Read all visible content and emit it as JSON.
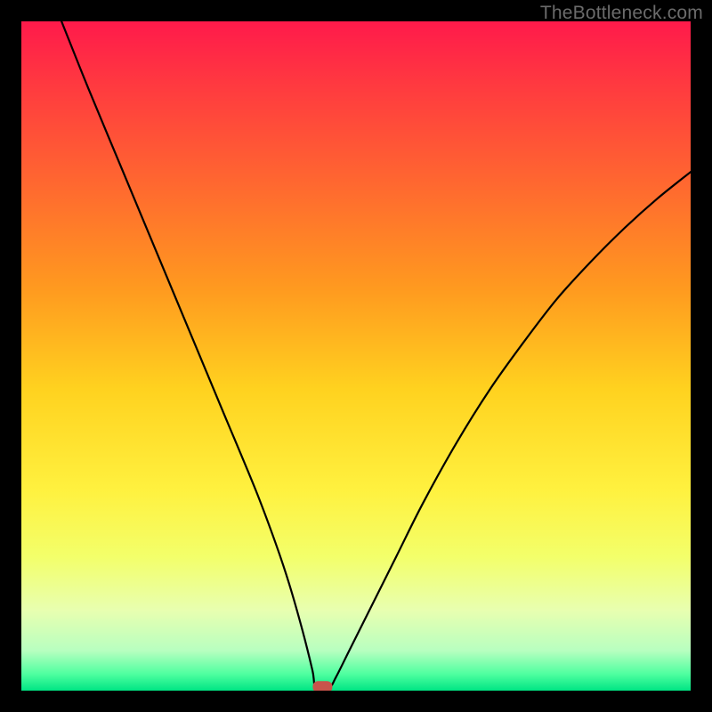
{
  "watermark": "TheBottleneck.com",
  "chart_data": {
    "type": "line",
    "title": "",
    "xlabel": "",
    "ylabel": "",
    "xlim": [
      0,
      100
    ],
    "ylim": [
      0,
      100
    ],
    "series": [
      {
        "name": "curve",
        "x": [
          6,
          10,
          15,
          20,
          25,
          30,
          35,
          38,
          40,
          42,
          43.5,
          44,
          46,
          47,
          49,
          52,
          56,
          60,
          65,
          70,
          75,
          80,
          85,
          90,
          95,
          100
        ],
        "y": [
          100,
          90,
          78,
          66,
          54,
          42,
          30,
          22,
          16,
          9,
          3,
          0.5,
          0.5,
          2,
          6,
          12,
          20,
          28,
          37,
          45,
          52,
          58.5,
          64,
          69,
          73.5,
          77.5
        ]
      }
    ],
    "marker": {
      "x": 45,
      "y": 0.5
    },
    "gradient_stops": [
      {
        "offset": 0.0,
        "color": "#ff1a4b"
      },
      {
        "offset": 0.1,
        "color": "#ff3b3f"
      },
      {
        "offset": 0.25,
        "color": "#ff6a2f"
      },
      {
        "offset": 0.4,
        "color": "#ff9a1f"
      },
      {
        "offset": 0.55,
        "color": "#ffd21f"
      },
      {
        "offset": 0.7,
        "color": "#fff13f"
      },
      {
        "offset": 0.8,
        "color": "#f3ff6a"
      },
      {
        "offset": 0.88,
        "color": "#e8ffb0"
      },
      {
        "offset": 0.94,
        "color": "#b8ffc0"
      },
      {
        "offset": 0.975,
        "color": "#4fffa0"
      },
      {
        "offset": 1.0,
        "color": "#00e584"
      }
    ]
  }
}
